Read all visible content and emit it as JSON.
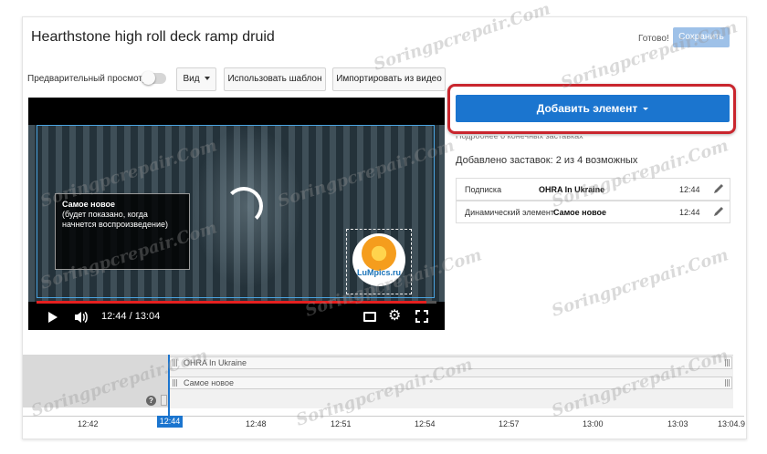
{
  "header": {
    "title": "Hearthstone high roll deck ramp druid",
    "status": "Готово!",
    "save_label": "Сохранить"
  },
  "toolbar": {
    "preview_label": "Предварительный просмотр",
    "preview_enabled": false,
    "view_label": "Вид",
    "use_template_label": "Использовать шаблон",
    "import_label": "Импортировать из видео"
  },
  "player": {
    "endcard_title": "Самое новое",
    "endcard_subtitle": "(будет показано, когда начнется воспроизведение)",
    "logo_text": "LuMpics.ru",
    "time_display": "12:44 / 13:04",
    "progress_fraction": 0.974
  },
  "panel": {
    "add_element_label": "Добавить элемент",
    "cut_text": "Подробнее о конечных заставках",
    "added_count_text": "Добавлено заставок: 2 из 4 возможных",
    "elements": [
      {
        "type": "Подписка",
        "value": "OHRA In Ukraine",
        "time": "12:44"
      },
      {
        "type": "Динамический элемент",
        "value": "Самое новое",
        "time": "12:44"
      }
    ]
  },
  "timeline": {
    "tracks": [
      "OHRA In Ukraine",
      "Самое новое"
    ],
    "playhead": "12:44",
    "ticks": [
      "12:42",
      "12:48",
      "12:51",
      "12:54",
      "12:57",
      "13:00",
      "13:03",
      "13:04.9"
    ]
  },
  "watermark": "Soringpcrepair.Com",
  "colors": {
    "accent": "#1b75cf",
    "highlight": "#c9262e",
    "progress": "#e52020"
  }
}
